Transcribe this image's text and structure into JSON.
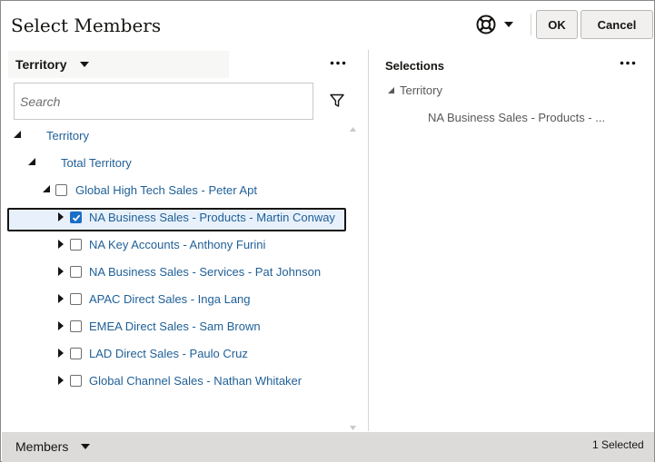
{
  "dialog": {
    "title": "Select Members",
    "ok_label": "OK",
    "cancel_label": "Cancel",
    "help_icon": "lifebuoy-icon"
  },
  "left_panel": {
    "dimension": "Territory",
    "search_placeholder": "Search",
    "tree": [
      {
        "label": "Territory",
        "expanded": true,
        "checkbox": false
      },
      {
        "label": "Total Territory",
        "expanded": true,
        "checkbox": false
      },
      {
        "label": "Global High Tech Sales - Peter Apt",
        "expanded": true,
        "checkbox": true,
        "checked": false
      },
      {
        "label": "NA Business Sales - Products - Martin Conway",
        "expanded": false,
        "checkbox": true,
        "checked": true,
        "selected": true
      },
      {
        "label": "NA Key Accounts - Anthony Furini",
        "expanded": false,
        "checkbox": true,
        "checked": false
      },
      {
        "label": "NA Business Sales - Services - Pat Johnson",
        "expanded": false,
        "checkbox": true,
        "checked": false
      },
      {
        "label": "APAC Direct Sales - Inga Lang",
        "expanded": false,
        "checkbox": true,
        "checked": false
      },
      {
        "label": "EMEA Direct Sales - Sam Brown",
        "expanded": false,
        "checkbox": true,
        "checked": false
      },
      {
        "label": "LAD Direct Sales - Paulo Cruz",
        "expanded": false,
        "checkbox": true,
        "checked": false
      },
      {
        "label": "Global Channel Sales - Nathan Whitaker",
        "expanded": false,
        "checkbox": true,
        "checked": false
      }
    ]
  },
  "right_panel": {
    "title": "Selections",
    "dimension": "Territory",
    "items": [
      "NA Business Sales - Products - ..."
    ]
  },
  "footer": {
    "label": "Members",
    "selected_count": "1 Selected"
  },
  "colors": {
    "link": "#1f5f97",
    "checkbox_checked": "#1a6ec6",
    "footer_bg": "#dcdbd9",
    "button_bg": "#f1f0ee"
  }
}
